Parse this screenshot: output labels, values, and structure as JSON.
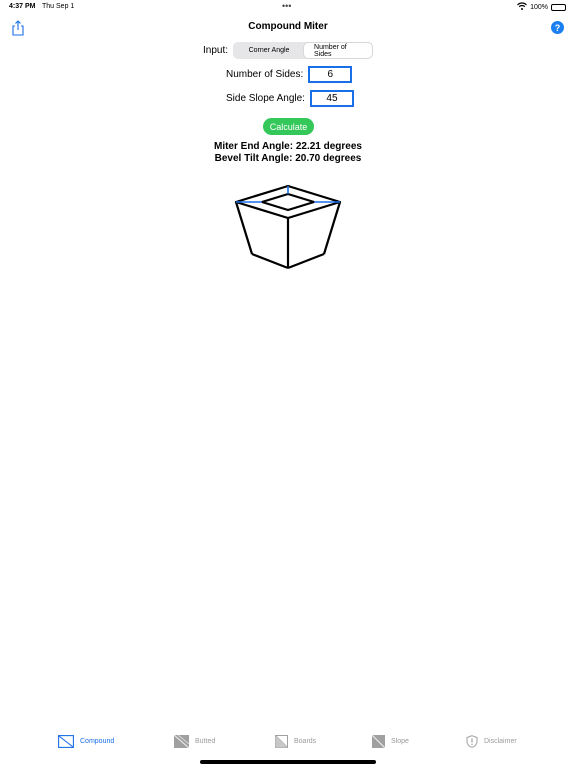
{
  "status_bar": {
    "time": "4:37 PM",
    "date": "Thu Sep 1",
    "dots": "•••",
    "battery": "100%"
  },
  "nav": {
    "title": "Compound Miter",
    "help_label": "?"
  },
  "input": {
    "label": "Input:",
    "options": [
      "Corner Angle",
      "Number of Sides"
    ],
    "selected": "Number of Sides"
  },
  "fields": {
    "sides_label": "Number of Sides:",
    "sides_value": "6",
    "slope_label": "Side Slope Angle:",
    "slope_value": "45"
  },
  "calculate_label": "Calculate",
  "results": {
    "miter": "Miter End Angle: 22.21 degrees",
    "bevel": "Bevel Tilt Angle: 20.70 degrees"
  },
  "tabs": [
    {
      "label": "Compound",
      "icon": "compound-icon",
      "active": true
    },
    {
      "label": "Butted",
      "icon": "butted-icon",
      "active": false
    },
    {
      "label": "Boards",
      "icon": "boards-icon",
      "active": false
    },
    {
      "label": "Slope",
      "icon": "slope-icon",
      "active": false
    },
    {
      "label": "Disclaimer",
      "icon": "shield-icon",
      "active": false
    }
  ],
  "colors": {
    "accent": "#1a6fe8",
    "calculate": "#34c759",
    "inactive_tab": "#9a9a9a"
  }
}
